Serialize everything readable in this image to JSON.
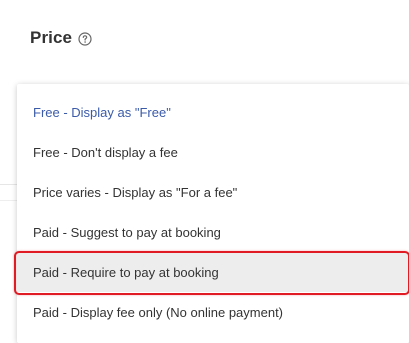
{
  "field": {
    "title": "Price",
    "help_icon": "question-circle-icon"
  },
  "dropdown": {
    "options": [
      {
        "label": "Free - Display as \"Free\"",
        "state": "selected"
      },
      {
        "label": "Free - Don't display a fee",
        "state": "normal"
      },
      {
        "label": "Price varies - Display as \"For a fee\"",
        "state": "normal"
      },
      {
        "label": "Paid - Suggest to pay at booking",
        "state": "normal"
      },
      {
        "label": "Paid - Require to pay at booking",
        "state": "hovered"
      },
      {
        "label": "Paid - Display fee only (No online payment)",
        "state": "normal"
      }
    ]
  },
  "colors": {
    "selected_text": "#3b5ba9",
    "hover_background": "#ededed",
    "highlight_outline": "#e01b24"
  }
}
